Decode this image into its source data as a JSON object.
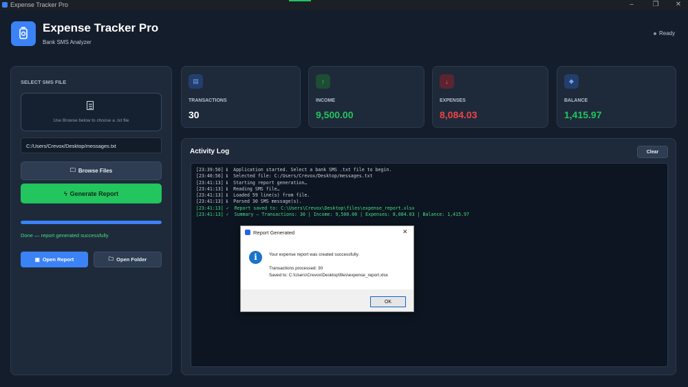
{
  "window": {
    "title": "Expense Tracker Pro",
    "controls": [
      "–",
      "❐",
      "✕"
    ]
  },
  "header": {
    "title": "Expense Tracker Pro",
    "subtitle": "Bank SMS Analyzer",
    "status": "Ready"
  },
  "left_panel": {
    "section_label": "SELECT SMS FILE",
    "drop_hint": "Use Browse below to choose a .txt file",
    "file_path": "C:/Users/Crevox/Desktop/messages.txt",
    "browse_label": "Browse Files",
    "generate_label": "Generate Report",
    "progress": 1.0,
    "done_text": "Done — report generated successfully",
    "open_report_label": "Open Report",
    "open_folder_label": "Open Folder"
  },
  "stats": {
    "transactions": {
      "label": "TRANSACTIONS",
      "value": "30",
      "color": "#ffffff",
      "icon": "list-icon"
    },
    "income": {
      "label": "INCOME",
      "value": "9,500.00",
      "color": "#22c55e",
      "icon": "arrow-up-icon"
    },
    "expenses": {
      "label": "EXPENSES",
      "value": "8,084.03",
      "color": "#ef4444",
      "icon": "arrow-down-icon"
    },
    "balance": {
      "label": "BALANCE",
      "value": "1,415.97",
      "color": "#22c55e",
      "icon": "diamond-icon"
    }
  },
  "log": {
    "title": "Activity Log",
    "clear_label": "Clear",
    "lines": [
      {
        "text": "[23:39:50] ℹ  Application started. Select a bank SMS .txt file to begin.",
        "ok": false
      },
      {
        "text": "[23:40:56] ℹ  Selected file: C:/Users/Crevox/Desktop/messages.txt",
        "ok": false
      },
      {
        "text": "[23:41:13] ℹ  Starting report generation…",
        "ok": false
      },
      {
        "text": "[23:41:13] ℹ  Reading SMS file…",
        "ok": false
      },
      {
        "text": "[23:41:13] ℹ  Loaded 59 line(s) from file.",
        "ok": false
      },
      {
        "text": "[23:41:13] ℹ  Parsed 30 SMS message(s).",
        "ok": false
      },
      {
        "text": "[23:41:13] ✓  Report saved to: C:\\Users\\Crevox\\Desktop\\files\\expense_report.xlsx",
        "ok": true
      },
      {
        "text": "[23:41:13] ✓  Summary — Transactions: 30 | Income: 9,500.00 | Expenses: 8,084.03 | Balance: 1,415.97",
        "ok": true
      }
    ]
  },
  "dialog": {
    "title": "Report Generated",
    "message": "Your expense report was created successfully.",
    "detail_1": "Transactions processed: 30",
    "detail_2": "Saved to: C:\\Users\\Crevox\\Desktop\\files\\expense_report.xlsx",
    "ok_label": "OK"
  }
}
